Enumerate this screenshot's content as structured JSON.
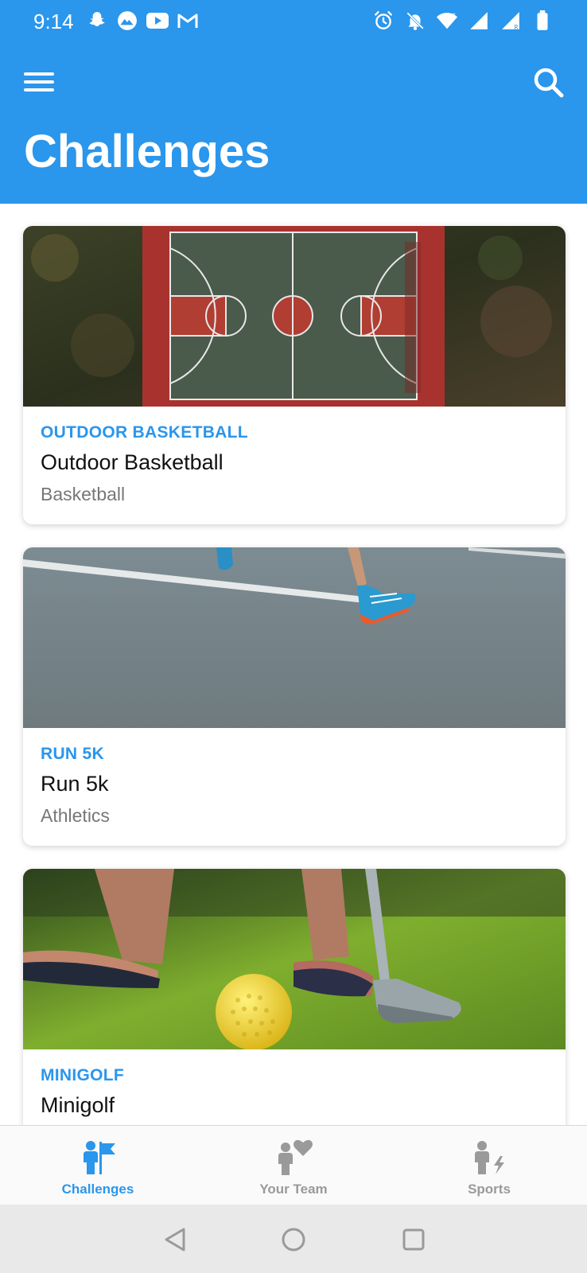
{
  "status_bar": {
    "time": "9:14",
    "left_icons": [
      "snapchat-icon",
      "mountain-app-icon",
      "youtube-icon",
      "gmail-icon"
    ],
    "right_icons": [
      "alarm-icon",
      "bell-off-icon",
      "wifi-icon",
      "signal-icon",
      "signal-roaming-icon",
      "battery-icon"
    ]
  },
  "header": {
    "title": "Challenges",
    "menu_icon": "hamburger-menu-icon",
    "search_icon": "search-icon",
    "background_color": "#2a96ec"
  },
  "cards": [
    {
      "kicker": "OUTDOOR BASKETBALL",
      "title": "Outdoor Basketball",
      "sport": "Basketball",
      "image": "basketball-court-aerial-photo"
    },
    {
      "kicker": "RUN 5K",
      "title": "Run 5k",
      "sport": "Athletics",
      "image": "runner-shoes-asphalt-photo"
    },
    {
      "kicker": "MINIGOLF",
      "title": "Minigolf",
      "sport": "",
      "image": "minigolf-putter-ball-photo"
    }
  ],
  "tabs": [
    {
      "label": "Challenges",
      "icon": "person-flag-icon",
      "active": true
    },
    {
      "label": "Your Team",
      "icon": "person-heart-icon",
      "active": false
    },
    {
      "label": "Sports",
      "icon": "person-bolt-icon",
      "active": false
    }
  ],
  "system_nav": [
    "back-icon",
    "home-icon",
    "recents-icon"
  ],
  "colors": {
    "accent": "#2a96ec",
    "inactive": "#9a9a9a",
    "text": "#111111",
    "subtext": "#777777"
  }
}
